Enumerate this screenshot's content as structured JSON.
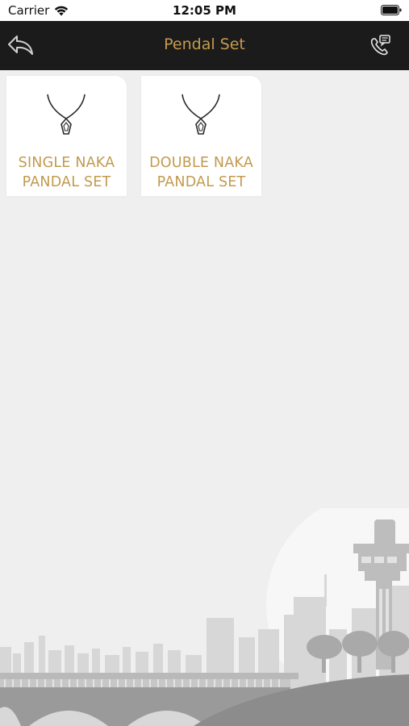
{
  "status_bar": {
    "carrier": "Carrier",
    "time": "12:05 PM"
  },
  "nav": {
    "title": "Pendal Set",
    "back_icon": "back-arrow-icon",
    "call_icon": "phone-message-icon"
  },
  "categories": [
    {
      "label": "SINGLE NAKA\nPANDAL SET",
      "icon": "pendant-necklace-icon"
    },
    {
      "label": "DOUBLE NAKA\nPANDAL SET",
      "icon": "pendant-necklace-icon"
    }
  ],
  "colors": {
    "accent": "#c69b4c",
    "nav_background": "#1b1b1b",
    "page_background": "#efefef"
  }
}
